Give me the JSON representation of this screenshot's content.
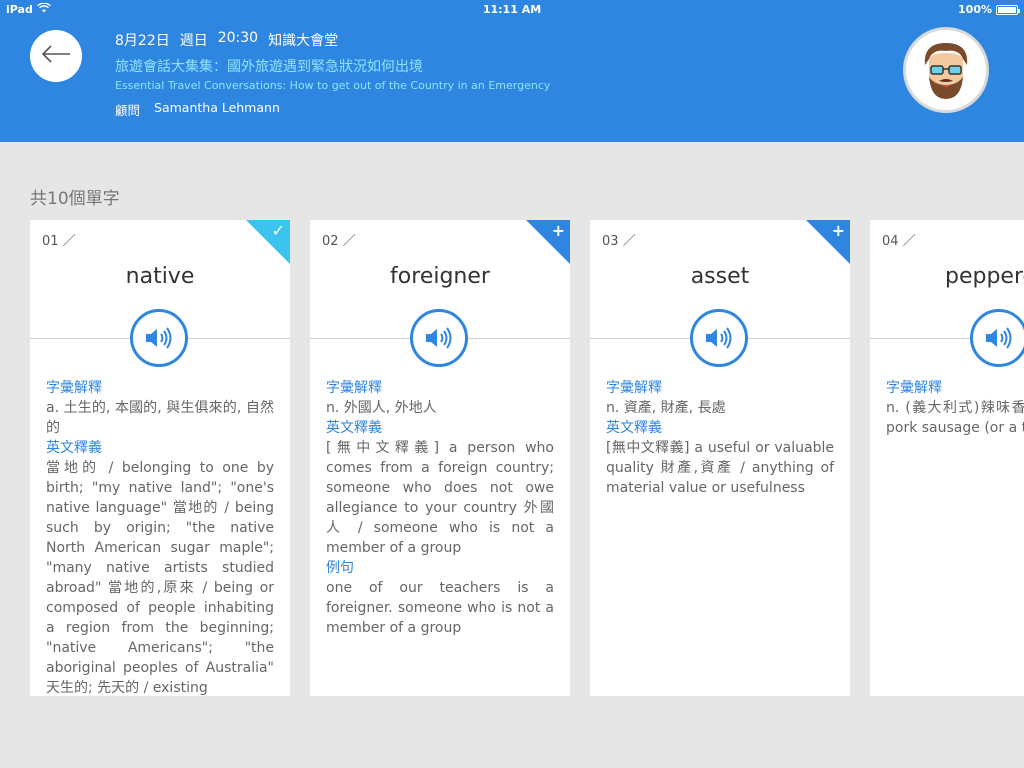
{
  "status_bar": {
    "device": "iPad",
    "time": "11:11 AM",
    "battery": "100%"
  },
  "header": {
    "date": "8月22日",
    "weekday": "週日",
    "time": "20:30",
    "venue": "知識大會堂",
    "title": "旅遊會話大集集：國外旅遊遇到緊急狀況如何出境",
    "subtitle": "Essential Travel Conversations: How to get out of the Country in an Emergency",
    "advisor_label": "顧問",
    "advisor_name": "Samantha Lehmann"
  },
  "section_label": "共10個單字",
  "colors": {
    "accent": "#2f86e0",
    "done": "#3cc4f0"
  },
  "cards": [
    {
      "number": "01 ／",
      "word": "native",
      "state": "check",
      "glyph": "✓",
      "def_label": "字彙解釋",
      "definition": "a. 土生的, 本國的, 與生俱來的, 自然的",
      "eng_label": "英文釋義",
      "english": "當地的 / belonging to one by birth; \"my native land\"; \"one's native language\" 當地的 / being such by origin; \"the native North American sugar maple\"; \"many native artists studied abroad\" 當地的,原來 / being or composed of people inhabiting a region from the beginning; \"native Americans\"; \"the aboriginal peoples of Australia\" 天生的; 先天的 / existing"
    },
    {
      "number": "02 ／",
      "word": "foreigner",
      "state": "add",
      "glyph": "+",
      "def_label": "字彙解釋",
      "definition": "n. 外國人, 外地人",
      "eng_label": "英文釋義",
      "english": "[無中文釋義] a person who comes from a foreign country; someone who does not owe allegiance to your country 外國人 / someone who is not a member of a group",
      "ex_label": "例句",
      "example": "one of our teachers is a foreigner. someone who is not a member of a group"
    },
    {
      "number": "03 ／",
      "word": "asset",
      "state": "add",
      "glyph": "+",
      "def_label": "字彙解釋",
      "definition": "n. 資產, 財產, 長處",
      "eng_label": "英文釋義",
      "english": "[無中文釋義] a useful or valuable quality 財產,資產 / anything of material value or usefulness"
    },
    {
      "number": "04 ／",
      "word": "peppero",
      "state": "add",
      "glyph": "",
      "def_label": "字彙解釋",
      "definition": "n. (義大利式)辣味香腸",
      "eng_label": "",
      "english": "中文釋義] a pork sausage (or a thin sausage)"
    }
  ]
}
